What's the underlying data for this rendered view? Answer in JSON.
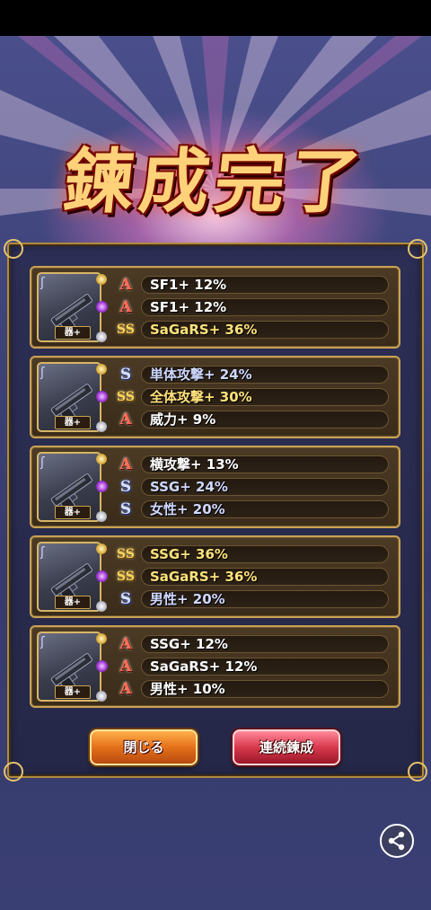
{
  "title": "鍊成完了",
  "cards": [
    {
      "tag": "器+",
      "rows": [
        {
          "badge": "A",
          "text": "SF1+ 12%"
        },
        {
          "badge": "A",
          "text": "SF1+ 12%"
        },
        {
          "badge": "SS",
          "text": "SaGaRS+ 36%"
        }
      ]
    },
    {
      "tag": "器+",
      "rows": [
        {
          "badge": "S",
          "text": "単体攻撃+ 24%"
        },
        {
          "badge": "SS",
          "text": "全体攻撃+ 30%"
        },
        {
          "badge": "A",
          "text": "威力+ 9%"
        }
      ]
    },
    {
      "tag": "器+",
      "rows": [
        {
          "badge": "A",
          "text": "横攻撃+ 13%"
        },
        {
          "badge": "S",
          "text": "SSG+ 24%"
        },
        {
          "badge": "S",
          "text": "女性+ 20%"
        }
      ]
    },
    {
      "tag": "器+",
      "rows": [
        {
          "badge": "SS",
          "text": "SSG+ 36%"
        },
        {
          "badge": "SS",
          "text": "SaGaRS+ 36%"
        },
        {
          "badge": "S",
          "text": "男性+ 20%"
        }
      ]
    },
    {
      "tag": "器+",
      "rows": [
        {
          "badge": "A",
          "text": "SSG+ 12%"
        },
        {
          "badge": "A",
          "text": "SaGaRS+ 12%"
        },
        {
          "badge": "A",
          "text": "男性+ 10%"
        }
      ]
    }
  ],
  "buttons": {
    "close": "閉じる",
    "continue": "連続鍊成"
  },
  "icons": {
    "weapon": "handgun-icon",
    "share": "share-icon"
  },
  "colors": {
    "rank_A": "#ff6d55",
    "rank_S": "#d6e2ff",
    "rank_SS": "#ffd45c",
    "frame_gold": "#c9a253"
  }
}
